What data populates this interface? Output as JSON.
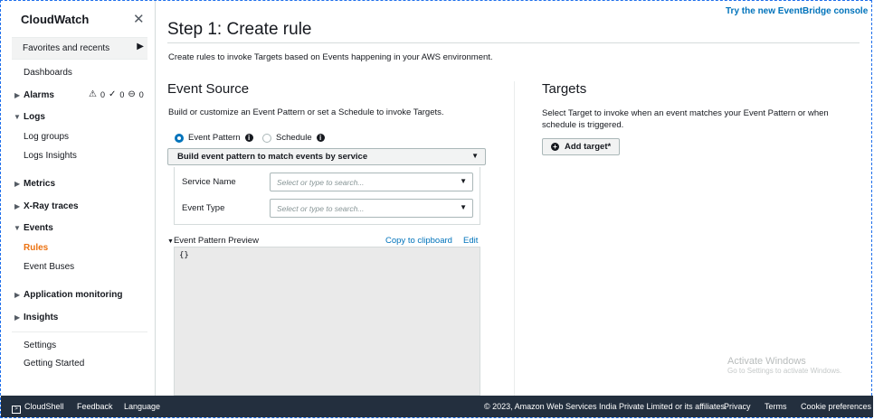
{
  "sidebar": {
    "title": "CloudWatch",
    "favorites": "Favorites and recents",
    "items": [
      {
        "label": "Dashboards"
      },
      {
        "label": "Alarms",
        "counts": {
          "alarm": "0",
          "ok": "0",
          "insufficient": "0"
        }
      },
      {
        "label": "Logs"
      },
      {
        "label": "Log groups"
      },
      {
        "label": "Logs Insights"
      },
      {
        "label": "Metrics"
      },
      {
        "label": "X-Ray traces"
      },
      {
        "label": "Events"
      },
      {
        "label": "Rules"
      },
      {
        "label": "Event Buses"
      },
      {
        "label": "Application monitoring"
      },
      {
        "label": "Insights"
      },
      {
        "label": "Settings"
      },
      {
        "label": "Getting Started"
      }
    ]
  },
  "header": {
    "eventbridge_link": "Try the new EventBridge console",
    "title": "Step 1: Create rule",
    "description": "Create rules to invoke Targets based on Events happening in your AWS environment."
  },
  "event_source": {
    "title": "Event Source",
    "description": "Build or customize an Event Pattern or set a Schedule to invoke Targets.",
    "radio_event_pattern": "Event Pattern",
    "radio_schedule": "Schedule",
    "selected": "Event Pattern",
    "build_dropdown": "Build event pattern to match events by service",
    "service_name_label": "Service Name",
    "service_name_placeholder": "Select or type to search...",
    "event_type_label": "Event Type",
    "event_type_placeholder": "Select or type to search...",
    "preview_label": "Event Pattern Preview",
    "copy_link": "Copy to clipboard",
    "edit_link": "Edit",
    "preview_code": "{}"
  },
  "targets": {
    "title": "Targets",
    "description_line1": "Select Target to invoke when an event matches your Event Pattern or when",
    "description_line2": "schedule is triggered.",
    "add_button": "Add target*"
  },
  "watermark": {
    "line1": "Activate Windows",
    "line2": "Go to Settings to activate Windows."
  },
  "footer": {
    "cloudshell": "CloudShell",
    "feedback": "Feedback",
    "language": "Language",
    "copyright": "© 2023, Amazon Web Services India Private Limited or its affiliates.",
    "privacy": "Privacy",
    "terms": "Terms",
    "cookies": "Cookie preferences"
  },
  "colors": {
    "accent_active": "#ec7211",
    "link": "#0073bb",
    "footer_bg": "#232f3e"
  }
}
